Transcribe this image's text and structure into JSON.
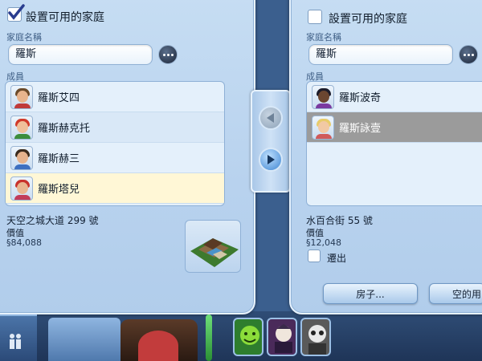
{
  "left_panel": {
    "checkbox_label": "設置可用的家庭",
    "checkbox_checked": true,
    "family_name_label": "家庭名稱",
    "family_name_value": "羅斯",
    "members_label": "成員",
    "members": [
      {
        "name": "羅斯艾四"
      },
      {
        "name": "羅斯赫克托"
      },
      {
        "name": "羅斯赫三"
      },
      {
        "name": "羅斯塔兒"
      }
    ],
    "address": "天空之城大道 299 號",
    "value_label": "價值",
    "value": "§84,088"
  },
  "right_panel": {
    "checkbox_label": "設置可用的家庭",
    "checkbox_checked": false,
    "family_name_label": "家庭名稱",
    "family_name_value": "羅斯",
    "members_label": "成員",
    "members": [
      {
        "name": "羅斯波奇"
      },
      {
        "name": "羅斯詠壹"
      }
    ],
    "address": "水百合街 55 號",
    "value_label": "價值",
    "value": "§12,048",
    "move_out_label": "遷出",
    "house_button": "房子...",
    "empty_lot_button": "空的用"
  },
  "colors": {
    "panel": "#c6ddf3",
    "selected_row": "#9b9b9b",
    "highlight_row": "#fff7d6",
    "active_arrow": "#3f86d2"
  }
}
